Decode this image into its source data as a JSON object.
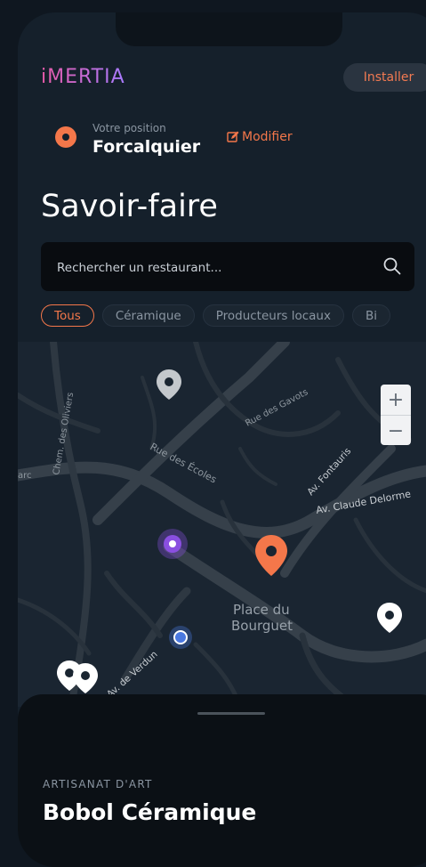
{
  "header": {
    "logo_text": "iMERTIA",
    "install_label": "Installer"
  },
  "location": {
    "caption": "Votre position",
    "city": "Forcalquier",
    "modify_label": "Modifier"
  },
  "page_title": "Savoir-faire",
  "search": {
    "placeholder": "Rechercher un restaurant..."
  },
  "filters": [
    {
      "label": "Tous",
      "active": true
    },
    {
      "label": "Céramique",
      "active": false
    },
    {
      "label": "Producteurs locaux",
      "active": false
    },
    {
      "label": "Bi",
      "active": false
    }
  ],
  "map": {
    "street_labels": {
      "rue_des_gavots": "Rue des Gavots",
      "rue_des_ecoles": "Rue des Écoles",
      "chem_des_oliviers": "Chem. des Oliviers",
      "av_fontauris": "Av. Fontauris",
      "av_claude_delorme": "Av. Claude Delorme",
      "arc": "arc",
      "place_line1": "Place du",
      "place_line2": "Bourguet",
      "av_de_verdun": "Av. de Verdun"
    },
    "zoom_in": "+",
    "zoom_out": "−",
    "colors": {
      "selected_marker": "#f4774a",
      "marker": "#ffffff",
      "grey_marker": "#c4c8cc",
      "purple_marker": "#8a4fe0",
      "user_position": "#4a78e0"
    }
  },
  "sheet": {
    "category": "ARTISANAT D'ART",
    "name": "Bobol Céramique"
  },
  "accent_color": "#f4774a"
}
